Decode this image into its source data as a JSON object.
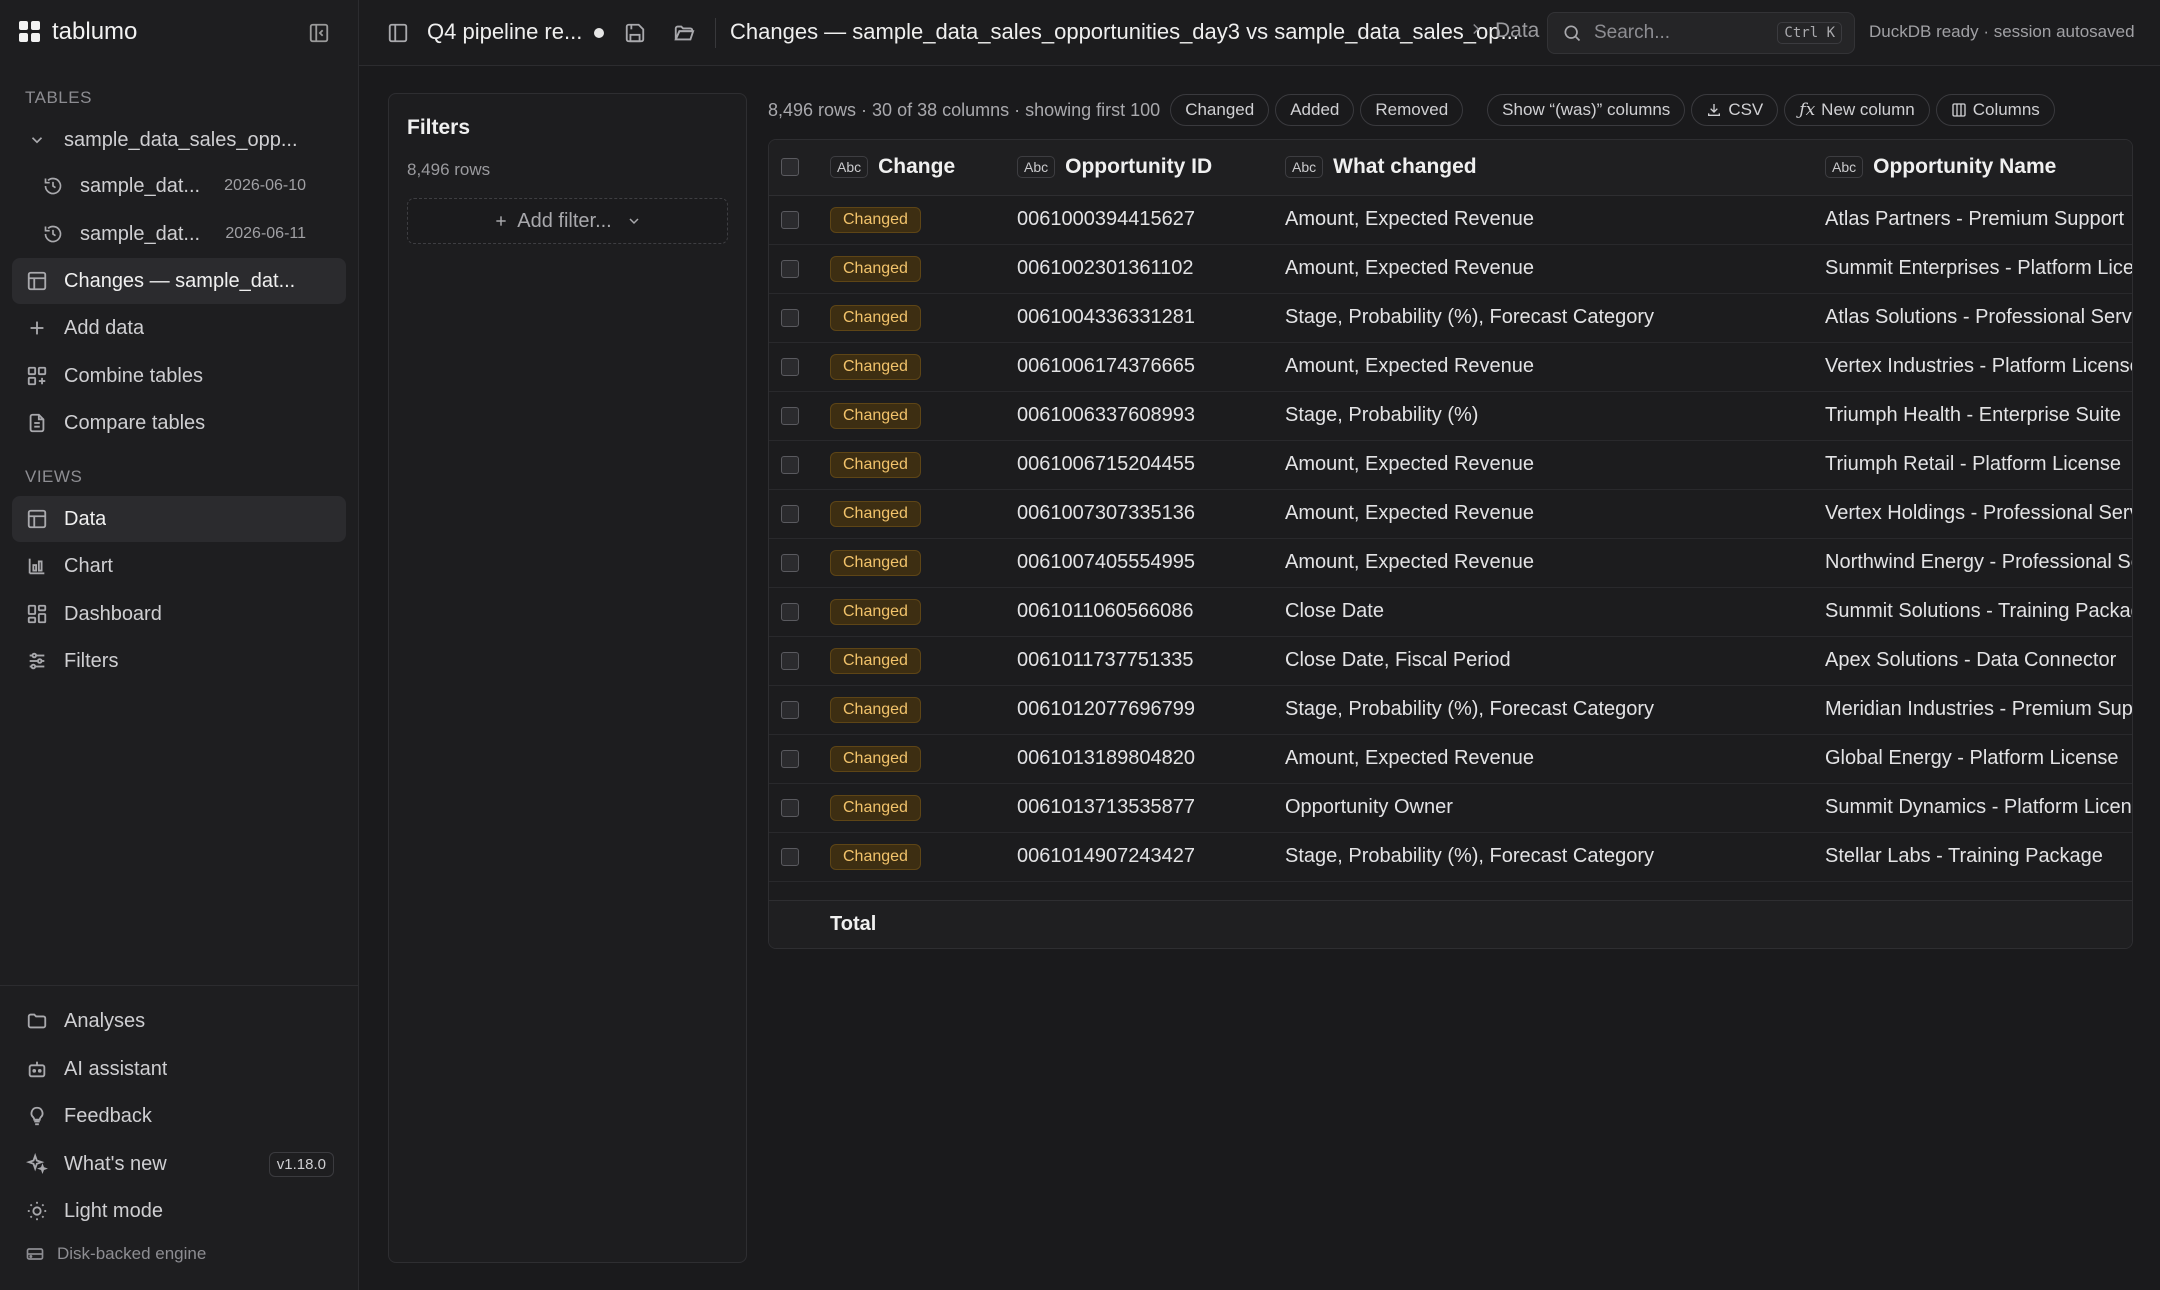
{
  "app": {
    "name": "tablumo"
  },
  "sidebar": {
    "tables_label": "TABLES",
    "table_group": "sample_data_sales_opp...",
    "snapshots": [
      {
        "label": "sample_dat...",
        "date": "2026-06-10"
      },
      {
        "label": "sample_dat...",
        "date": "2026-06-11"
      }
    ],
    "changes_item": "Changes — sample_dat...",
    "actions": [
      "Add data",
      "Combine tables",
      "Compare tables"
    ],
    "views_label": "VIEWS",
    "views": [
      "Data",
      "Chart",
      "Dashboard",
      "Filters"
    ],
    "bottom": {
      "analyses": "Analyses",
      "ai_assistant": "AI assistant",
      "feedback": "Feedback",
      "whats_new": "What's new",
      "version": "v1.18.0",
      "light_mode": "Light mode",
      "engine": "Disk-backed engine"
    }
  },
  "topbar": {
    "analysis_name": "Q4 pipeline re...",
    "breadcrumb_main": "Changes — sample_data_sales_opportunities_day3 vs sample_data_sales_op...",
    "breadcrumb_sub": "Data",
    "search_placeholder": "Search...",
    "shortcut": "Ctrl K",
    "status": "DuckDB ready · session autosaved"
  },
  "filters": {
    "title": "Filters",
    "row_count": "8,496 rows",
    "add_filter": "Add filter..."
  },
  "toolbar": {
    "summary": "8,496 rows · 30 of 38 columns · showing first 100",
    "chips": [
      "Changed",
      "Added",
      "Removed"
    ],
    "show_was": "Show “(was)” columns",
    "csv": "CSV",
    "new_column": "New column",
    "columns": "Columns"
  },
  "table": {
    "type_label": "Abc",
    "columns": [
      "Change",
      "Opportunity ID",
      "What changed",
      "Opportunity Name"
    ],
    "rows": [
      [
        "Changed",
        "0061000394415627",
        "Amount, Expected Revenue",
        "Atlas Partners - Premium Support"
      ],
      [
        "Changed",
        "0061002301361102",
        "Amount, Expected Revenue",
        "Summit Enterprises - Platform License"
      ],
      [
        "Changed",
        "0061004336331281",
        "Stage, Probability (%), Forecast Category",
        "Atlas Solutions - Professional Services"
      ],
      [
        "Changed",
        "0061006174376665",
        "Amount, Expected Revenue",
        "Vertex Industries - Platform License"
      ],
      [
        "Changed",
        "0061006337608993",
        "Stage, Probability (%)",
        "Triumph Health - Enterprise Suite"
      ],
      [
        "Changed",
        "0061006715204455",
        "Amount, Expected Revenue",
        "Triumph Retail - Platform License"
      ],
      [
        "Changed",
        "0061007307335136",
        "Amount, Expected Revenue",
        "Vertex Holdings - Professional Services"
      ],
      [
        "Changed",
        "0061007405554995",
        "Amount, Expected Revenue",
        "Northwind Energy - Professional Services"
      ],
      [
        "Changed",
        "0061011060566086",
        "Close Date",
        "Summit Solutions - Training Package"
      ],
      [
        "Changed",
        "0061011737751335",
        "Close Date, Fiscal Period",
        "Apex Solutions - Data Connector"
      ],
      [
        "Changed",
        "0061012077696799",
        "Stage, Probability (%), Forecast Category",
        "Meridian Industries - Premium Support"
      ],
      [
        "Changed",
        "0061013189804820",
        "Amount, Expected Revenue",
        "Global Energy - Platform License"
      ],
      [
        "Changed",
        "0061013713535877",
        "Opportunity Owner",
        "Summit Dynamics - Platform License"
      ],
      [
        "Changed",
        "0061014907243427",
        "Stage, Probability (%), Forecast Category",
        "Stellar Labs - Training Package"
      ]
    ],
    "total_label": "Total"
  }
}
